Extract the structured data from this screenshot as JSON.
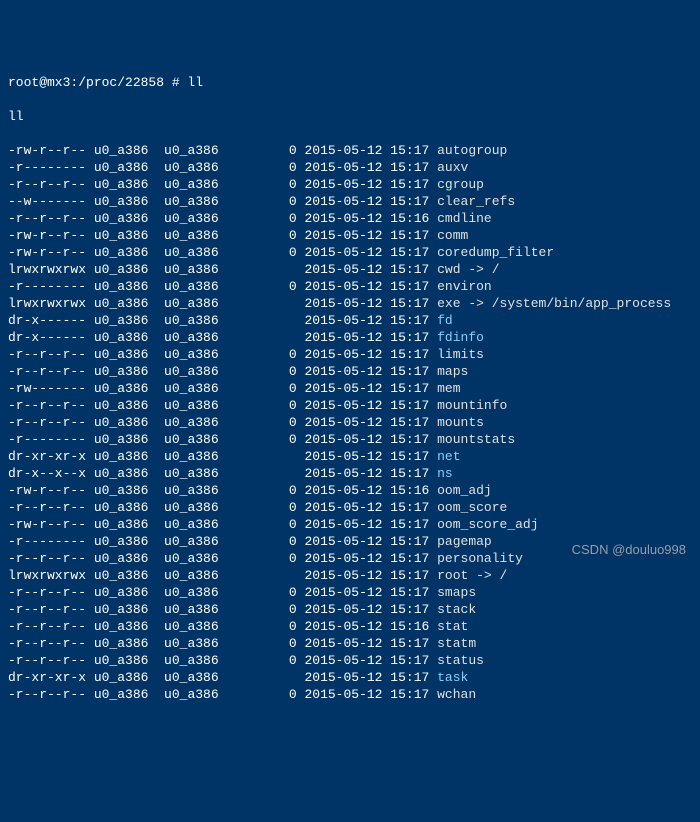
{
  "prompt": "root@mx3:/proc/22858 # ll",
  "command_echo": "ll",
  "bottom_prompt_fragment": "",
  "watermark": "CSDN @douluo998",
  "rows": [
    {
      "perm": "-rw-r--r--",
      "owner": "u0_a386",
      "group": "u0_a386",
      "size": "0",
      "date": "2015-05-12",
      "time": "15:17",
      "name": "autogroup",
      "color": "file"
    },
    {
      "perm": "-r--------",
      "owner": "u0_a386",
      "group": "u0_a386",
      "size": "0",
      "date": "2015-05-12",
      "time": "15:17",
      "name": "auxv",
      "color": "file"
    },
    {
      "perm": "-r--r--r--",
      "owner": "u0_a386",
      "group": "u0_a386",
      "size": "0",
      "date": "2015-05-12",
      "time": "15:17",
      "name": "cgroup",
      "color": "file"
    },
    {
      "perm": "--w-------",
      "owner": "u0_a386",
      "group": "u0_a386",
      "size": "0",
      "date": "2015-05-12",
      "time": "15:17",
      "name": "clear_refs",
      "color": "file"
    },
    {
      "perm": "-r--r--r--",
      "owner": "u0_a386",
      "group": "u0_a386",
      "size": "0",
      "date": "2015-05-12",
      "time": "15:16",
      "name": "cmdline",
      "color": "file"
    },
    {
      "perm": "-rw-r--r--",
      "owner": "u0_a386",
      "group": "u0_a386",
      "size": "0",
      "date": "2015-05-12",
      "time": "15:17",
      "name": "comm",
      "color": "file"
    },
    {
      "perm": "-rw-r--r--",
      "owner": "u0_a386",
      "group": "u0_a386",
      "size": "0",
      "date": "2015-05-12",
      "time": "15:17",
      "name": "coredump_filter",
      "color": "file"
    },
    {
      "perm": "lrwxrwxrwx",
      "owner": "u0_a386",
      "group": "u0_a386",
      "size": "",
      "date": "2015-05-12",
      "time": "15:17",
      "name": "cwd -> /",
      "color": "link"
    },
    {
      "perm": "-r--------",
      "owner": "u0_a386",
      "group": "u0_a386",
      "size": "0",
      "date": "2015-05-12",
      "time": "15:17",
      "name": "environ",
      "color": "file"
    },
    {
      "perm": "lrwxrwxrwx",
      "owner": "u0_a386",
      "group": "u0_a386",
      "size": "",
      "date": "2015-05-12",
      "time": "15:17",
      "name": "exe -> /system/bin/app_process",
      "color": "link"
    },
    {
      "perm": "dr-x------",
      "owner": "u0_a386",
      "group": "u0_a386",
      "size": "",
      "date": "2015-05-12",
      "time": "15:17",
      "name": "fd",
      "color": "dir"
    },
    {
      "perm": "dr-x------",
      "owner": "u0_a386",
      "group": "u0_a386",
      "size": "",
      "date": "2015-05-12",
      "time": "15:17",
      "name": "fdinfo",
      "color": "dir"
    },
    {
      "perm": "-r--r--r--",
      "owner": "u0_a386",
      "group": "u0_a386",
      "size": "0",
      "date": "2015-05-12",
      "time": "15:17",
      "name": "limits",
      "color": "file"
    },
    {
      "perm": "-r--r--r--",
      "owner": "u0_a386",
      "group": "u0_a386",
      "size": "0",
      "date": "2015-05-12",
      "time": "15:17",
      "name": "maps",
      "color": "file"
    },
    {
      "perm": "-rw-------",
      "owner": "u0_a386",
      "group": "u0_a386",
      "size": "0",
      "date": "2015-05-12",
      "time": "15:17",
      "name": "mem",
      "color": "file"
    },
    {
      "perm": "-r--r--r--",
      "owner": "u0_a386",
      "group": "u0_a386",
      "size": "0",
      "date": "2015-05-12",
      "time": "15:17",
      "name": "mountinfo",
      "color": "file"
    },
    {
      "perm": "-r--r--r--",
      "owner": "u0_a386",
      "group": "u0_a386",
      "size": "0",
      "date": "2015-05-12",
      "time": "15:17",
      "name": "mounts",
      "color": "file"
    },
    {
      "perm": "-r--------",
      "owner": "u0_a386",
      "group": "u0_a386",
      "size": "0",
      "date": "2015-05-12",
      "time": "15:17",
      "name": "mountstats",
      "color": "file"
    },
    {
      "perm": "dr-xr-xr-x",
      "owner": "u0_a386",
      "group": "u0_a386",
      "size": "",
      "date": "2015-05-12",
      "time": "15:17",
      "name": "net",
      "color": "dir"
    },
    {
      "perm": "dr-x--x--x",
      "owner": "u0_a386",
      "group": "u0_a386",
      "size": "",
      "date": "2015-05-12",
      "time": "15:17",
      "name": "ns",
      "color": "dir"
    },
    {
      "perm": "-rw-r--r--",
      "owner": "u0_a386",
      "group": "u0_a386",
      "size": "0",
      "date": "2015-05-12",
      "time": "15:16",
      "name": "oom_adj",
      "color": "file"
    },
    {
      "perm": "-r--r--r--",
      "owner": "u0_a386",
      "group": "u0_a386",
      "size": "0",
      "date": "2015-05-12",
      "time": "15:17",
      "name": "oom_score",
      "color": "file"
    },
    {
      "perm": "-rw-r--r--",
      "owner": "u0_a386",
      "group": "u0_a386",
      "size": "0",
      "date": "2015-05-12",
      "time": "15:17",
      "name": "oom_score_adj",
      "color": "file"
    },
    {
      "perm": "-r--------",
      "owner": "u0_a386",
      "group": "u0_a386",
      "size": "0",
      "date": "2015-05-12",
      "time": "15:17",
      "name": "pagemap",
      "color": "file"
    },
    {
      "perm": "-r--r--r--",
      "owner": "u0_a386",
      "group": "u0_a386",
      "size": "0",
      "date": "2015-05-12",
      "time": "15:17",
      "name": "personality",
      "color": "file"
    },
    {
      "perm": "lrwxrwxrwx",
      "owner": "u0_a386",
      "group": "u0_a386",
      "size": "",
      "date": "2015-05-12",
      "time": "15:17",
      "name": "root -> /",
      "color": "link"
    },
    {
      "perm": "-r--r--r--",
      "owner": "u0_a386",
      "group": "u0_a386",
      "size": "0",
      "date": "2015-05-12",
      "time": "15:17",
      "name": "smaps",
      "color": "file"
    },
    {
      "perm": "-r--r--r--",
      "owner": "u0_a386",
      "group": "u0_a386",
      "size": "0",
      "date": "2015-05-12",
      "time": "15:17",
      "name": "stack",
      "color": "file"
    },
    {
      "perm": "-r--r--r--",
      "owner": "u0_a386",
      "group": "u0_a386",
      "size": "0",
      "date": "2015-05-12",
      "time": "15:16",
      "name": "stat",
      "color": "file"
    },
    {
      "perm": "-r--r--r--",
      "owner": "u0_a386",
      "group": "u0_a386",
      "size": "0",
      "date": "2015-05-12",
      "time": "15:17",
      "name": "statm",
      "color": "file"
    },
    {
      "perm": "-r--r--r--",
      "owner": "u0_a386",
      "group": "u0_a386",
      "size": "0",
      "date": "2015-05-12",
      "time": "15:17",
      "name": "status",
      "color": "file"
    },
    {
      "perm": "dr-xr-xr-x",
      "owner": "u0_a386",
      "group": "u0_a386",
      "size": "",
      "date": "2015-05-12",
      "time": "15:17",
      "name": "task",
      "color": "dir"
    },
    {
      "perm": "-r--r--r--",
      "owner": "u0_a386",
      "group": "u0_a386",
      "size": "0",
      "date": "2015-05-12",
      "time": "15:17",
      "name": "wchan",
      "color": "file"
    }
  ]
}
